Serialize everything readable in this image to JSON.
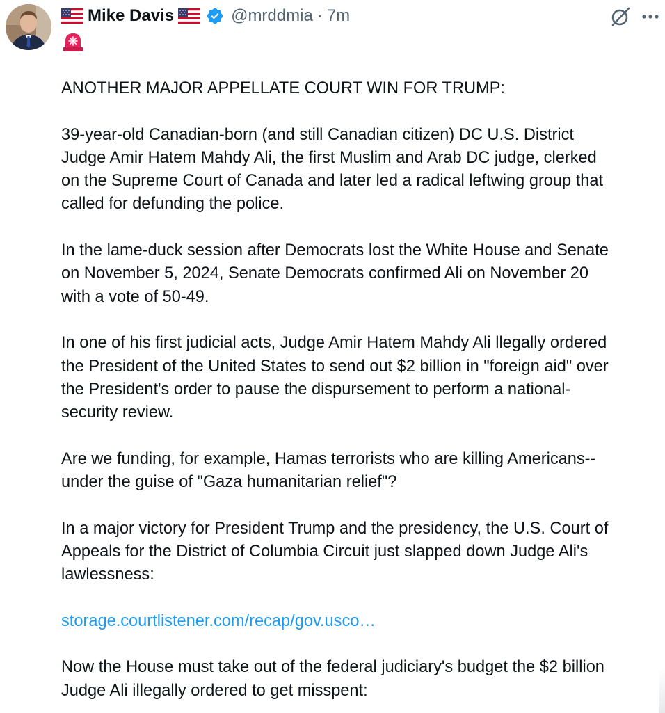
{
  "author": {
    "name": "Mike Davis",
    "handle": "@mrddmia",
    "separator": "·",
    "time": "7m"
  },
  "icons": {
    "avatar": "avatar-photo",
    "flag_left": "us-flag-icon",
    "flag_right": "us-flag-icon",
    "verified": "verified-badge-icon",
    "grok": "grok-icon",
    "more": "more-icon",
    "siren": "siren-icon"
  },
  "colors": {
    "text": "#0f1419",
    "secondary": "#536471",
    "link": "#1d9bf0",
    "verified": "#1d9bf0",
    "siren": "#e0245e"
  },
  "post": {
    "p1": "ANOTHER MAJOR APPELLATE COURT WIN FOR TRUMP:",
    "p2": "39-year-old Canadian-born (and still Canadian citizen) DC U.S. District\nJudge Amir Hatem Mahdy Ali, the first Muslim and Arab DC judge, clerked\non the Supreme Court of Canada and later led a radical leftwing group that\ncalled for defunding the police.",
    "p3": "In the lame-duck session after Democrats lost the White House and Senate\non November 5, 2024, Senate Democrats confirmed Ali on November 20\nwith a vote of 50-49.",
    "p4": "In one of his first judicial acts, Judge Amir Hatem Mahdy Ali llegally ordered\nthe President of the United States to send out $2 billion in \"foreign aid\" over\nthe President's order to pause the dispursement to perform a national-\nsecurity review.",
    "p5": "Are we funding, for example, Hamas terrorists who are killing Americans--\nunder the guise of \"Gaza humanitarian relief\"?",
    "p6": "In a major victory for President Trump and the presidency, the U.S. Court of\nAppeals for the District of Columbia Circuit just slapped down Judge Ali's\nlawlessness:",
    "link": "storage.courtlistener.com/recap/gov.usco…",
    "p7": "Now the House must take out of the federal judiciary's budget the $2 billion\nJudge Ali illegally ordered to get misspent:"
  }
}
